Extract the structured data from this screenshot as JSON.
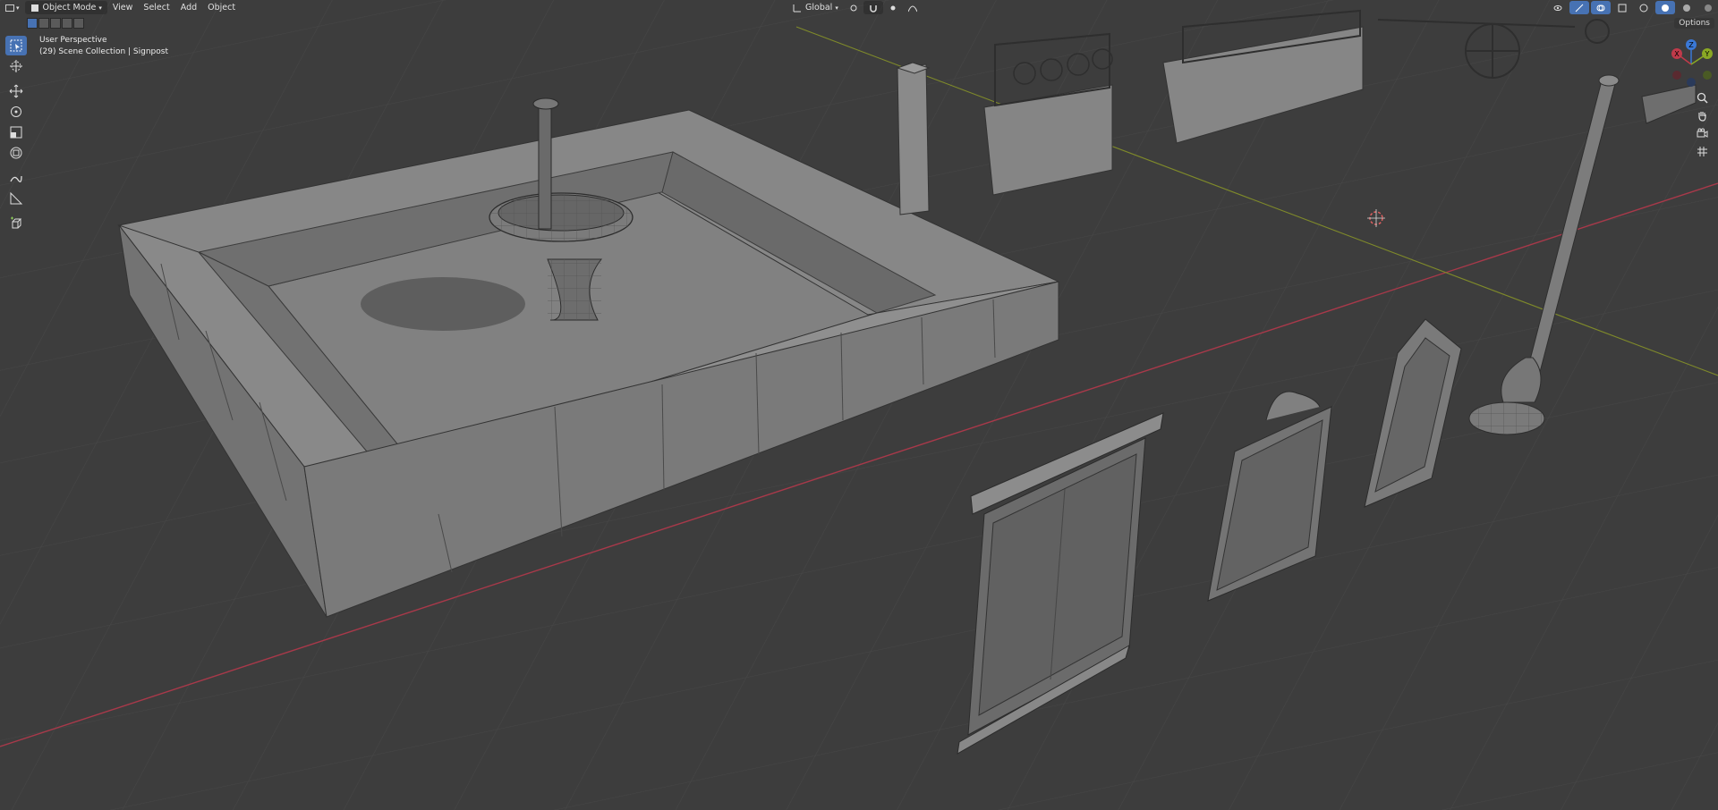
{
  "header": {
    "mode_label": "Object Mode",
    "menus": [
      "View",
      "Select",
      "Add",
      "Object"
    ],
    "transform_orientation": "Global"
  },
  "viewport": {
    "perspective_label": "User Perspective",
    "collection_label": "(29) Scene Collection | Signpost"
  },
  "overlays": {
    "options_label": "Options"
  },
  "gizmo": {
    "x_label": "X",
    "y_label": "Y",
    "z_label": "Z"
  },
  "colors": {
    "background": "#3d3d3d",
    "accent": "#4772b3",
    "x_axis": "#c03a4a",
    "y_axis": "#8aa824",
    "z_axis": "#3a78d6",
    "mesh": "#7c7c7c"
  },
  "toolbar": {
    "tools": [
      "select-box-icon",
      "cursor-icon",
      "move-icon",
      "rotate-icon",
      "scale-icon",
      "transform-icon",
      "annotate-icon",
      "measure-icon",
      "add-cube-icon"
    ]
  }
}
